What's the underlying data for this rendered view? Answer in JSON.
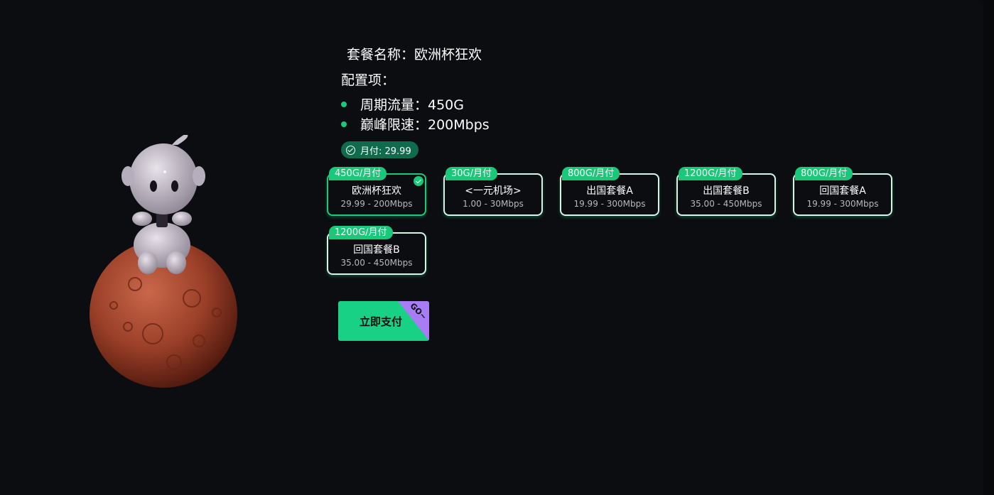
{
  "package": {
    "title": "套餐名称：欧洲杯狂欢",
    "config_label": "配置项：",
    "features": [
      "周期流量：450G",
      "巅峰限速：200Mbps"
    ],
    "price_pill": "月付: 29.99"
  },
  "plans": [
    {
      "tag": "450G/月付",
      "name": "欧洲杯狂欢",
      "desc": "29.99 - 200Mbps",
      "selected": true
    },
    {
      "tag": "30G/月付",
      "name": "<一元机场>",
      "desc": "1.00 - 30Mbps",
      "selected": false
    },
    {
      "tag": "800G/月付",
      "name": "出国套餐A",
      "desc": "19.99 - 300Mbps",
      "selected": false
    },
    {
      "tag": "1200G/月付",
      "name": "出国套餐B",
      "desc": "35.00 - 450Mbps",
      "selected": false
    },
    {
      "tag": "800G/月付",
      "name": "回国套餐A",
      "desc": "19.99 - 300Mbps",
      "selected": false
    },
    {
      "tag": "1200G/月付",
      "name": "回国套餐B",
      "desc": "35.00 - 450Mbps",
      "selected": false
    }
  ],
  "pay_button": {
    "label": "立即支付",
    "corner": "GO~"
  },
  "colors": {
    "accent": "#19c879",
    "background": "#0c0d10",
    "corner": "#a77cf5"
  },
  "icons": {
    "illustration": "astronaut-on-planet-illustration",
    "check": "check-circle-icon"
  }
}
